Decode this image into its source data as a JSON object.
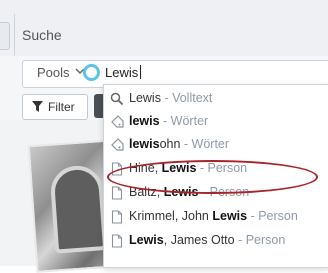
{
  "app": {
    "title": "Suche"
  },
  "search": {
    "pools_label": "Pools",
    "query": "Lewis"
  },
  "toolbar": {
    "filter_label": "Filter"
  },
  "suggestions": [
    {
      "icon": "search-icon",
      "pre": "",
      "bold": "",
      "plain": "Lewis",
      "post": "",
      "type": " - Volltext"
    },
    {
      "icon": "tag-icon",
      "pre": "",
      "bold": "lewis",
      "plain": "",
      "post": "",
      "type": " - Wörter"
    },
    {
      "icon": "tag-icon",
      "pre": "",
      "bold": "lewis",
      "plain": "",
      "post": "ohn",
      "type": " - Wörter"
    },
    {
      "icon": "document-icon",
      "pre": "Hine, ",
      "bold": "Lewis",
      "plain": "",
      "post": "",
      "type": " - Person"
    },
    {
      "icon": "document-icon",
      "pre": "Baltz, ",
      "bold": "Lewis",
      "plain": "",
      "post": "",
      "type": " - Person"
    },
    {
      "icon": "document-icon",
      "pre": "Krimmel, John ",
      "bold": "Lewis",
      "plain": "",
      "post": "",
      "type": " - Person"
    },
    {
      "icon": "document-icon",
      "pre": "",
      "bold": "Lewis",
      "plain": "",
      "post": ", James Otto",
      "type": " - Person"
    }
  ],
  "colors": {
    "highlight_ring": "#a8232a",
    "cursor_ring": "#5fc3e6",
    "secondary_text": "#8f9aa6"
  }
}
